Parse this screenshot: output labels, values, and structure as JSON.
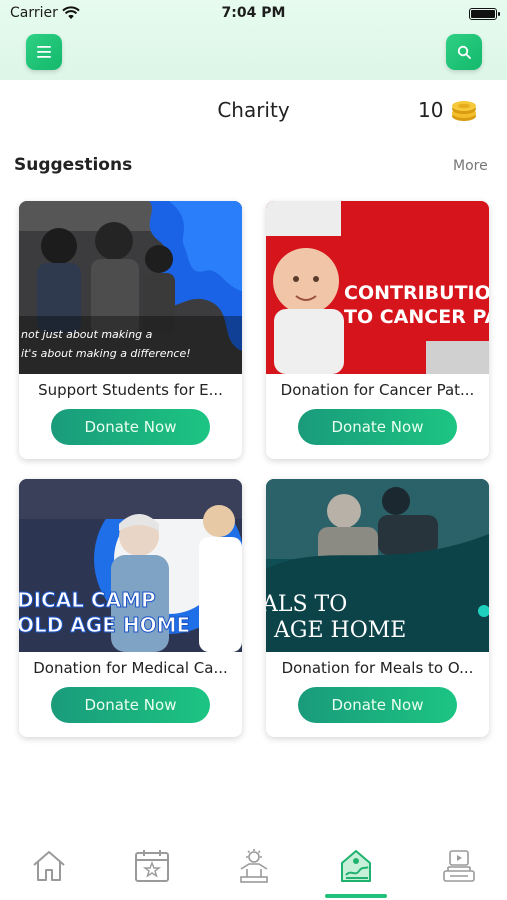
{
  "status_bar": {
    "carrier": "Carrier",
    "time": "7:04 PM"
  },
  "header": {
    "title": "Charity",
    "coin_count": "10"
  },
  "suggestions": {
    "title": "Suggestions",
    "more_label": "More"
  },
  "cards": [
    {
      "title": "Support Students for E...",
      "button": "Donate Now",
      "image_caption": "not just about making a / it's about making a difference!"
    },
    {
      "title": "Donation for Cancer Pat...",
      "button": "Donate Now",
      "image_caption": "CONTRIBUTION TO CANCER PATIE"
    },
    {
      "title": "Donation for Medical Ca...",
      "button": "Donate Now",
      "image_caption": "DICAL CAMP / OLD AGE HOME"
    },
    {
      "title": "Donation for Meals to O...",
      "button": "Donate Now",
      "image_caption": "ALS TO / AGE HOME"
    }
  ],
  "tabbar": {
    "items": [
      "home-icon",
      "calendar-icon",
      "charity-icon",
      "donate-icon",
      "media-icon"
    ],
    "active_index": 3
  },
  "colors": {
    "accent": "#1cc582",
    "accent_dark": "#1a9b7b",
    "topbar": "#e3f9ec"
  }
}
